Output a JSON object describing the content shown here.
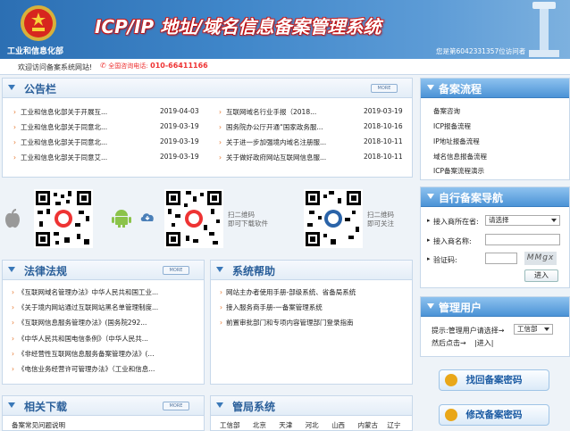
{
  "header": {
    "org_name": "工业和信息化部",
    "site_title": "ICP/IP 地址/域名信息备案管理系统",
    "visitor_text": "您是第6042331357位访问者"
  },
  "infobar": {
    "welcome": "欢迎访问备案系统网站!",
    "hotline_label": "全国咨询电话:",
    "hotline_number": "010-66411166"
  },
  "announcements": {
    "title": "公告栏",
    "more": "MORE",
    "left": [
      {
        "text": "工业和信息化部关于开展互...",
        "date": "2019-04-03"
      },
      {
        "text": "工业和信息化部关于同意北...",
        "date": "2019-03-19"
      },
      {
        "text": "工业和信息化部关于同意北...",
        "date": "2019-03-19"
      },
      {
        "text": "工业和信息化部关于同意艾...",
        "date": "2019-03-19"
      }
    ],
    "right": [
      {
        "text": "互联网域名行业手报（2018...",
        "date": "2019-03-19"
      },
      {
        "text": "国务院办公厅开通“国家政务服...",
        "date": "2018-10-16"
      },
      {
        "text": "关于进一步加强境内域名注册服...",
        "date": "2018-10-11"
      },
      {
        "text": "关于做好政府网站互联网信息服...",
        "date": "2018-10-11"
      }
    ]
  },
  "qr": {
    "caption1_line1": "扫二维码",
    "caption1_line2": "即可下载软件",
    "caption2_line1": "扫二维码",
    "caption2_line2": "即可关注"
  },
  "laws": {
    "title": "法律法规",
    "more": "MORE",
    "items": [
      "《互联网域名管理办法》中华人民共和国工业...",
      "《关于境内网站通过互联网站黑名单管理制度...",
      "《互联网信息服务管理办法》(国务院292...",
      "《中华人民共和国电信条例》（中华人民共...",
      "《非经营性互联网信息服务备案管理办法》(...",
      "《电信业务经营许可管理办法》（工业和信息..."
    ]
  },
  "help": {
    "title": "系统帮助",
    "items": [
      "网站主办者使用手册-部级系统、省备局系统",
      "接入服务商手册-一备案管理系统",
      "前置审批部门和专项内容管理部门登录指南"
    ]
  },
  "downloads": {
    "title": "相关下载",
    "more": "MORE",
    "items": [
      "备案常见问题说明"
    ]
  },
  "bureau": {
    "title": "管局系统",
    "items": [
      "工信部",
      "北京",
      "天津",
      "河北",
      "山西",
      "内蒙古",
      "辽宁"
    ]
  },
  "flow": {
    "title": "备案流程",
    "items": [
      "备案咨询",
      "ICP报备流程",
      "IP地址报备流程",
      "域名信息报备流程",
      "ICP备案流程演示"
    ]
  },
  "nav": {
    "title": "自行备案导航",
    "province_label": "接入商所在省:",
    "province_value": "请选择",
    "name_label": "接入商名称:",
    "captcha_label": "验证码:",
    "captcha_image_text": "MMgx",
    "submit": "进入"
  },
  "user_mgmt": {
    "title": "管理用户",
    "hint_prefix": "提示:管理用户请选择→",
    "role_value": "工信部",
    "hint_suffix": "然后点击→",
    "enter_link": "进入"
  },
  "buttons": {
    "retrieve_password": "找回备案密码",
    "change_password": "修改备案密码"
  }
}
